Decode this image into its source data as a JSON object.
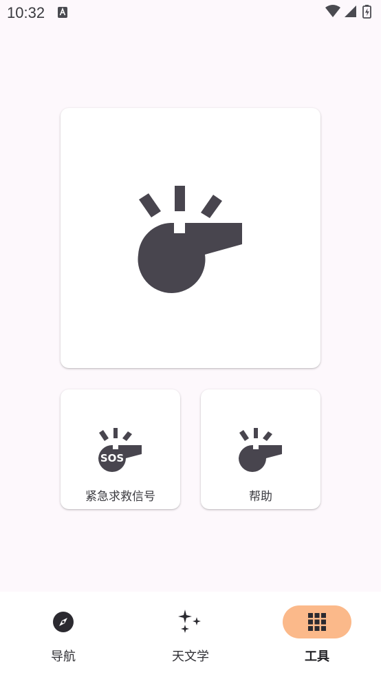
{
  "status_bar": {
    "time": "10:32"
  },
  "main": {
    "primary_tool": {
      "icon": "whistle-icon"
    },
    "tools": [
      {
        "label": "紧急求救信号",
        "icon": "sos-whistle-icon"
      },
      {
        "label": "帮助",
        "icon": "whistle-icon"
      }
    ]
  },
  "bottom_nav": {
    "items": [
      {
        "label": "导航",
        "icon": "compass-icon",
        "active": false
      },
      {
        "label": "天文学",
        "icon": "sparkles-icon",
        "active": false
      },
      {
        "label": "工具",
        "icon": "grid-icon",
        "active": true
      }
    ]
  },
  "colors": {
    "background": "#fdf8fc",
    "icon": "#48454e",
    "active_pill": "#fbb98a"
  }
}
